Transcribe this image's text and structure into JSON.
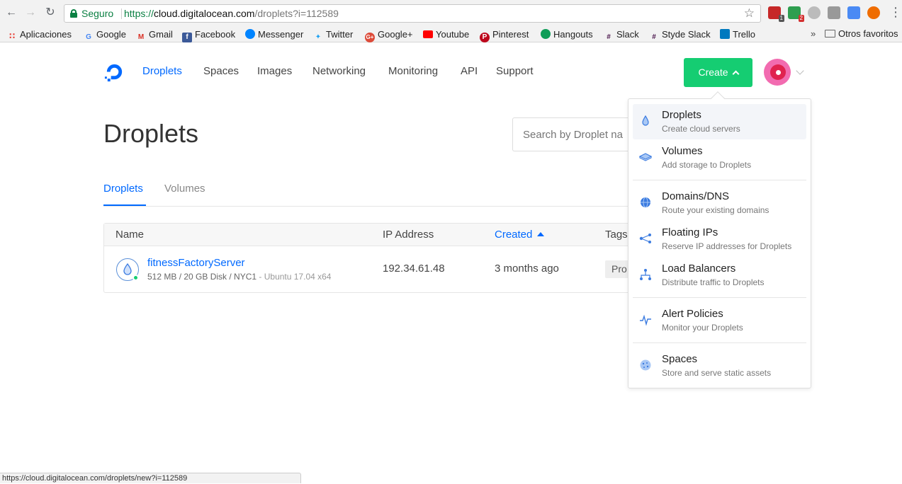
{
  "browser": {
    "secure_label": "Seguro",
    "url_scheme": "https://",
    "url_host": "cloud.digitalocean.com",
    "url_path": "/droplets?i=112589",
    "ext_badge_1": "1",
    "ext_badge_2": "2"
  },
  "bookmarks": [
    {
      "label": "Aplicaciones",
      "icon": "apps-grid-icon",
      "color": "#e8453c"
    },
    {
      "label": "Google",
      "icon": "google-icon",
      "color": "#4285f4"
    },
    {
      "label": "Gmail",
      "icon": "gmail-icon",
      "color": "#d93025"
    },
    {
      "label": "Facebook",
      "icon": "facebook-icon",
      "color": "#3b5998"
    },
    {
      "label": "Messenger",
      "icon": "messenger-icon",
      "color": "#0084ff"
    },
    {
      "label": "Twitter",
      "icon": "twitter-icon",
      "color": "#1da1f2"
    },
    {
      "label": "Google+",
      "icon": "google-plus-icon",
      "color": "#dd4b39"
    },
    {
      "label": "Youtube",
      "icon": "youtube-icon",
      "color": "#ff0000"
    },
    {
      "label": "Pinterest",
      "icon": "pinterest-icon",
      "color": "#bd081c"
    },
    {
      "label": "Hangouts",
      "icon": "hangouts-icon",
      "color": "#0f9d58"
    },
    {
      "label": "Slack",
      "icon": "slack-icon",
      "color": "#4a154b"
    },
    {
      "label": "Styde Slack",
      "icon": "slack-icon",
      "color": "#4a154b"
    },
    {
      "label": "Trello",
      "icon": "trello-icon",
      "color": "#0079bf"
    }
  ],
  "bookmarks_more": "»",
  "bookmarks_folder": "Otros favoritos",
  "nav": {
    "items": [
      "Droplets",
      "Spaces",
      "Images",
      "Networking",
      "Monitoring",
      "API",
      "Support"
    ],
    "active": "Droplets",
    "create_label": "Create"
  },
  "page": {
    "title": "Droplets",
    "search_placeholder": "Search by Droplet na",
    "tabs": [
      "Droplets",
      "Volumes"
    ]
  },
  "table": {
    "headers": [
      "Name",
      "IP Address",
      "Created",
      "Tags"
    ],
    "rows": [
      {
        "name": "fitnessFactoryServer",
        "meta": "512 MB / 20 GB Disk / NYC1",
        "os": " - Ubuntu 17.04 x64",
        "ip": "192.34.61.48",
        "created": "3 months ago",
        "tag": "Pro"
      }
    ]
  },
  "create_menu": [
    {
      "title": "Droplets",
      "subtitle": "Create cloud servers",
      "icon": "droplet-icon"
    },
    {
      "title": "Volumes",
      "subtitle": "Add storage to Droplets",
      "icon": "volume-icon"
    },
    {
      "title": "Domains/DNS",
      "subtitle": "Route your existing domains",
      "icon": "globe-icon"
    },
    {
      "title": "Floating IPs",
      "subtitle": "Reserve IP addresses for Droplets",
      "icon": "floating-ip-icon"
    },
    {
      "title": "Load Balancers",
      "subtitle": "Distribute traffic to Droplets",
      "icon": "load-balancer-icon"
    },
    {
      "title": "Alert Policies",
      "subtitle": "Monitor your Droplets",
      "icon": "alert-pulse-icon"
    },
    {
      "title": "Spaces",
      "subtitle": "Store and serve static assets",
      "icon": "spaces-icon"
    }
  ],
  "status_bar": "https://cloud.digitalocean.com/droplets/new?i=112589",
  "colors": {
    "accent": "#0069ff",
    "create": "#15cd72",
    "online": "#15cd72"
  }
}
